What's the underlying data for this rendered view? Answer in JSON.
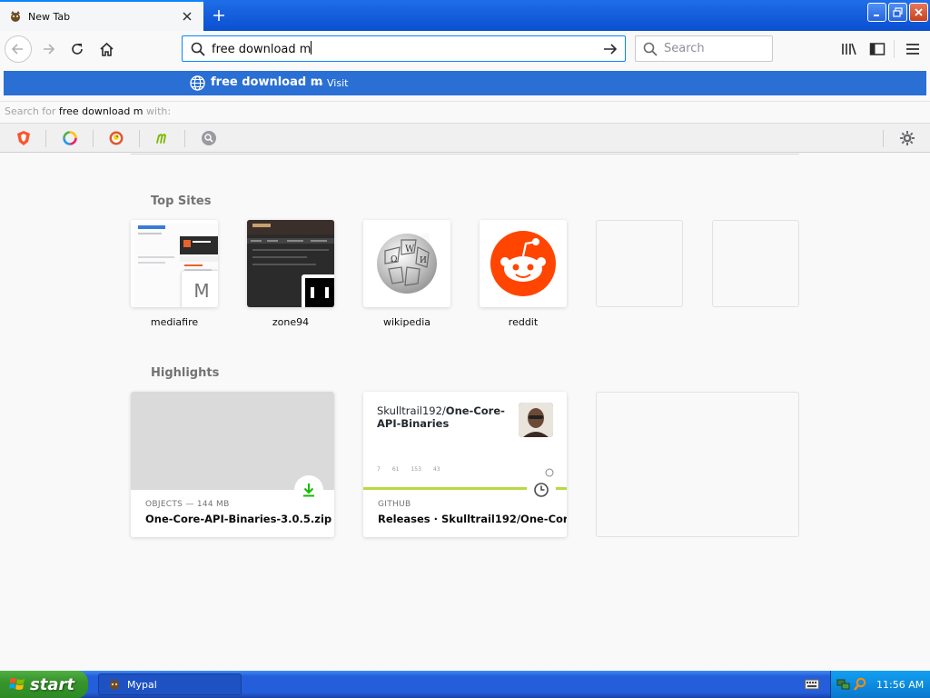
{
  "tab": {
    "title": "New Tab"
  },
  "urlbar": {
    "value": "free download m"
  },
  "searchbar": {
    "placeholder": "Search"
  },
  "suggestion": {
    "title": "free download m",
    "dash": "—",
    "action": "Visit"
  },
  "search_for": {
    "prefix": "Search for",
    "term": "free download m",
    "suffix": "with:"
  },
  "top_sites": {
    "heading": "Top Sites",
    "items": [
      {
        "label": "mediafire",
        "badge_letter": "M"
      },
      {
        "label": "zone94"
      },
      {
        "label": "wikipedia"
      },
      {
        "label": "reddit"
      }
    ]
  },
  "highlights": {
    "heading": "Highlights",
    "items": [
      {
        "context": "OBJECTS — 144 MB",
        "title": "One-Core-API-Binaries-3.0.5.zip"
      },
      {
        "context": "GITHUB",
        "title": "Releases · Skulltrail192/One-Cor...",
        "repo_owner": "Skulltrail192/",
        "repo_name": "One-Core-API-Binaries",
        "stats": [
          "7",
          "61",
          "153",
          "43"
        ]
      }
    ]
  },
  "taskbar": {
    "start_label": "start",
    "task_label": "Mypal",
    "clock": "11:56 AM"
  },
  "colors": {
    "accent": "#0a84ff",
    "suggestion_bg": "#2a6fd4",
    "reddit_orange": "#ff4500",
    "download_green": "#12bc00"
  }
}
